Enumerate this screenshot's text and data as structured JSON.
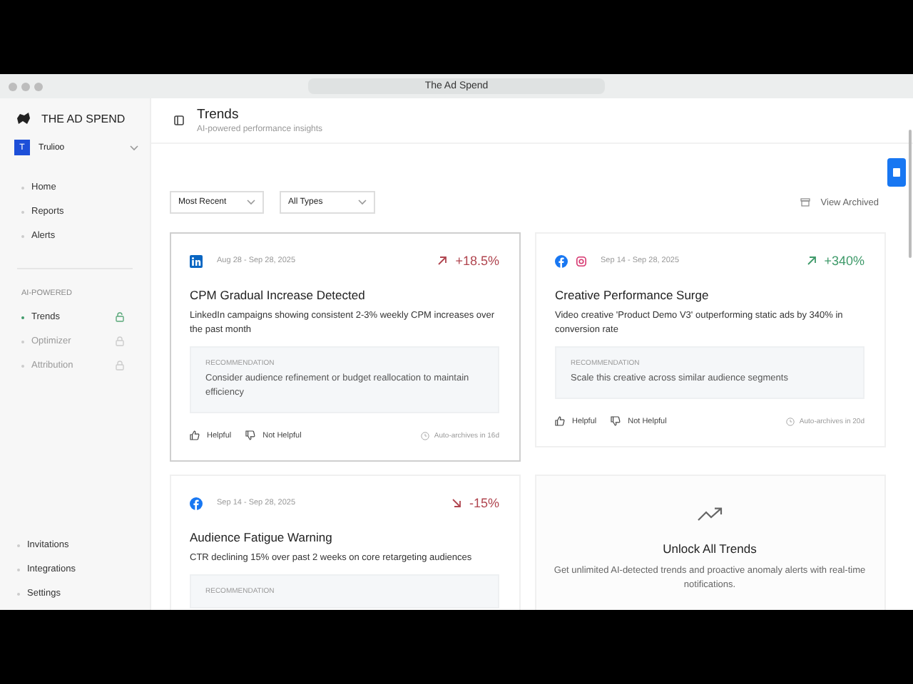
{
  "window": {
    "title": "The Ad Spend"
  },
  "sidebar": {
    "brand": "THE AD SPEND",
    "workspace": {
      "initial": "T",
      "name": "Trulioo"
    },
    "nav": [
      {
        "label": "Home",
        "selected": false
      },
      {
        "label": "Reports",
        "selected": false
      },
      {
        "label": "Alerts",
        "selected": false
      }
    ],
    "section_label": "AI-POWERED",
    "ai_items": [
      {
        "label": "Trends",
        "selected": true,
        "locked": false
      },
      {
        "label": "Optimizer",
        "selected": false,
        "locked": true
      },
      {
        "label": "Attribution",
        "selected": false,
        "locked": true
      }
    ],
    "bottom": [
      {
        "label": "Invitations"
      },
      {
        "label": "Integrations"
      },
      {
        "label": "Settings"
      }
    ]
  },
  "header": {
    "title": "Trends",
    "subtitle": "AI-powered performance insights"
  },
  "filters": [
    {
      "value": "Most Recent"
    },
    {
      "value": "All Types"
    }
  ],
  "view_archived": "View Archived",
  "cards": [
    {
      "kind": "trend",
      "highlighted": true,
      "platforms": [
        {
          "kind": "linkedin"
        }
      ],
      "dates": "Aug 28 - Sep 28, 2025",
      "trend": {
        "kind": "up",
        "color": "#b0454f"
      },
      "change": "+18.5%",
      "title": "CPM Gradual Increase Detected",
      "description": "LinkedIn campaigns showing consistent 2-3% weekly CPM increases over the past month",
      "recommendation_label": "RECOMMENDATION",
      "recommendation": "Consider audience refinement or budget reallocation to maintain efficiency",
      "helpful": "Helpful",
      "not_helpful": "Not Helpful",
      "archive": "Auto-archives in 16d"
    },
    {
      "kind": "trend",
      "highlighted": false,
      "platforms": [
        {
          "kind": "facebook"
        },
        {
          "kind": "instagram"
        }
      ],
      "dates": "Sep 14 - Sep 28, 2025",
      "trend": {
        "kind": "up",
        "color": "#3f9a6a"
      },
      "change": "+340%",
      "title": "Creative Performance Surge",
      "description": "Video creative 'Product Demo V3' outperforming static ads by 340% in conversion rate",
      "recommendation_label": "RECOMMENDATION",
      "recommendation": "Scale this creative across similar audience segments",
      "helpful": "Helpful",
      "not_helpful": "Not Helpful",
      "archive": "Auto-archives in 20d"
    },
    {
      "kind": "trend",
      "highlighted": false,
      "platforms": [
        {
          "kind": "facebook"
        }
      ],
      "dates": "Sep 14 - Sep 28, 2025",
      "trend": {
        "kind": "down",
        "color": "#b0454f"
      },
      "change": "-15%",
      "title": "Audience Fatigue Warning",
      "description": "CTR declining 15% over past 2 weeks on core retargeting audiences",
      "recommendation_label": "RECOMMENDATION"
    },
    {
      "kind": "unlock",
      "title": "Unlock All Trends",
      "description": "Get unlimited AI-detected trends and proactive anomaly alerts with real-time notifications."
    }
  ]
}
